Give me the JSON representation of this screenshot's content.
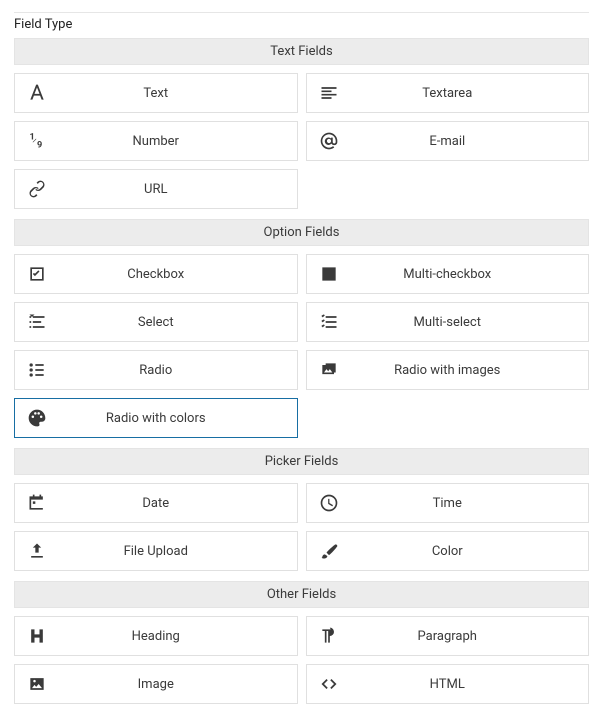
{
  "page_label": "Field Type",
  "selected": "radio-colors",
  "sections": [
    {
      "key": "text",
      "header": "Text Fields",
      "items": [
        {
          "key": "text",
          "label": "Text",
          "icon": "font-icon"
        },
        {
          "key": "textarea",
          "label": "Textarea",
          "icon": "align-left-icon"
        },
        {
          "key": "number",
          "label": "Number",
          "icon": "number-icon"
        },
        {
          "key": "email",
          "label": "E-mail",
          "icon": "at-icon"
        },
        {
          "key": "url",
          "label": "URL",
          "icon": "link-icon"
        }
      ]
    },
    {
      "key": "option",
      "header": "Option Fields",
      "items": [
        {
          "key": "checkbox",
          "label": "Checkbox",
          "icon": "checkbox-icon"
        },
        {
          "key": "multi-checkbox",
          "label": "Multi-checkbox",
          "icon": "checkbox-filled-icon"
        },
        {
          "key": "select",
          "label": "Select",
          "icon": "select-icon"
        },
        {
          "key": "multi-select",
          "label": "Multi-select",
          "icon": "multiselect-icon"
        },
        {
          "key": "radio",
          "label": "Radio",
          "icon": "radiolist-icon"
        },
        {
          "key": "radio-images",
          "label": "Radio with images",
          "icon": "image-group-icon"
        },
        {
          "key": "radio-colors",
          "label": "Radio with colors",
          "icon": "palette-icon"
        }
      ]
    },
    {
      "key": "picker",
      "header": "Picker Fields",
      "items": [
        {
          "key": "date",
          "label": "Date",
          "icon": "calendar-icon"
        },
        {
          "key": "time",
          "label": "Time",
          "icon": "clock-icon"
        },
        {
          "key": "upload",
          "label": "File Upload",
          "icon": "upload-icon"
        },
        {
          "key": "color",
          "label": "Color",
          "icon": "brush-icon"
        }
      ]
    },
    {
      "key": "other",
      "header": "Other Fields",
      "items": [
        {
          "key": "heading",
          "label": "Heading",
          "icon": "heading-icon"
        },
        {
          "key": "paragraph",
          "label": "Paragraph",
          "icon": "paragraph-icon"
        },
        {
          "key": "image",
          "label": "Image",
          "icon": "image-icon"
        },
        {
          "key": "html",
          "label": "HTML",
          "icon": "code-icon"
        }
      ]
    }
  ]
}
